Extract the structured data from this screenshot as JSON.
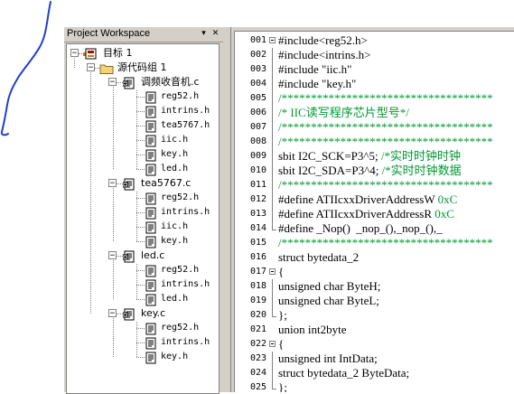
{
  "workspace": {
    "title": "Project Workspace",
    "pin_icon": "pin-icon",
    "close_icon": "close-icon",
    "tree": [
      {
        "id": "target",
        "label": "目标 1",
        "icon": "target-icon",
        "expander": "−",
        "depth": 0
      },
      {
        "id": "group",
        "label": "源代码组 1",
        "icon": "folder-icon",
        "expander": "−",
        "depth": 1
      },
      {
        "id": "f1",
        "label": "调频收音机.c",
        "icon": "c-file-icon",
        "expander": "−",
        "depth": 2
      },
      {
        "id": "f1a",
        "label": "reg52.h",
        "icon": "header-file-icon",
        "depth": 3
      },
      {
        "id": "f1b",
        "label": "intrins.h",
        "icon": "header-file-icon",
        "depth": 3
      },
      {
        "id": "f1c",
        "label": "tea5767.h",
        "icon": "header-file-icon",
        "depth": 3
      },
      {
        "id": "f1d",
        "label": "iic.h",
        "icon": "header-file-icon",
        "depth": 3
      },
      {
        "id": "f1e",
        "label": "key.h",
        "icon": "header-file-icon",
        "depth": 3
      },
      {
        "id": "f1f",
        "label": "led.h",
        "icon": "header-file-icon",
        "depth": 3
      },
      {
        "id": "f2",
        "label": "tea5767.c",
        "icon": "c-file-icon",
        "expander": "−",
        "depth": 2
      },
      {
        "id": "f2a",
        "label": "reg52.h",
        "icon": "header-file-icon",
        "depth": 3
      },
      {
        "id": "f2b",
        "label": "intrins.h",
        "icon": "header-file-icon",
        "depth": 3
      },
      {
        "id": "f2c",
        "label": "iic.h",
        "icon": "header-file-icon",
        "depth": 3
      },
      {
        "id": "f2d",
        "label": "key.h",
        "icon": "header-file-icon",
        "depth": 3
      },
      {
        "id": "f3",
        "label": "led.c",
        "icon": "c-file-icon",
        "expander": "−",
        "depth": 2
      },
      {
        "id": "f3a",
        "label": "reg52.h",
        "icon": "header-file-icon",
        "depth": 3
      },
      {
        "id": "f3b",
        "label": "intrins.h",
        "icon": "header-file-icon",
        "depth": 3
      },
      {
        "id": "f3c",
        "label": "led.h",
        "icon": "header-file-icon",
        "depth": 3
      },
      {
        "id": "f4",
        "label": "key.c",
        "icon": "c-file-icon",
        "expander": "−",
        "depth": 2
      },
      {
        "id": "f4a",
        "label": "reg52.h",
        "icon": "header-file-icon",
        "depth": 3
      },
      {
        "id": "f4b",
        "label": "intrins.h",
        "icon": "header-file-icon",
        "depth": 3
      },
      {
        "id": "f4c",
        "label": "key.h",
        "icon": "header-file-icon",
        "depth": 3
      }
    ]
  },
  "editor": {
    "lines": [
      {
        "n": "001",
        "text": "#include<reg52.h>",
        "kind": "code",
        "fold": "start"
      },
      {
        "n": "002",
        "text": "#include<intrins.h>",
        "kind": "code",
        "fold": "mid"
      },
      {
        "n": "003",
        "text": "#include \"iic.h\"",
        "kind": "code",
        "fold": "mid"
      },
      {
        "n": "004",
        "text": "#include \"key.h\"",
        "kind": "code",
        "fold": "mid"
      },
      {
        "n": "005",
        "text": "/************************************",
        "kind": "comment",
        "fold": "mid"
      },
      {
        "n": "006",
        "text": "/* IIC读写程序芯片型号*/",
        "kind": "comment",
        "fold": "mid"
      },
      {
        "n": "007",
        "text": "/************************************",
        "kind": "comment",
        "fold": "mid"
      },
      {
        "n": "008",
        "text": "/************************************",
        "kind": "comment",
        "fold": "mid"
      },
      {
        "n": "009",
        "text": "sbit I2C_SCK=P3^5; /*实时时钟时钟",
        "kind": "mixed",
        "code": "sbit I2C_SCK=P3^5; ",
        "comment": "/*实时时钟时钟",
        "fold": "mid"
      },
      {
        "n": "010",
        "text": "sbit I2C_SDA=P3^4; /*实时时钟数据",
        "kind": "mixed",
        "code": "sbit I2C_SDA=P3^4; ",
        "comment": "/*实时时钟数据",
        "fold": "mid"
      },
      {
        "n": "011",
        "text": "/************************************",
        "kind": "comment",
        "fold": "mid"
      },
      {
        "n": "012",
        "text": "#define ATIIcxxDriverAddressW 0xC",
        "kind": "mixed",
        "code": "#define ATIIcxxDriverAddressW ",
        "comment": "0xC",
        "fold": "mid"
      },
      {
        "n": "013",
        "text": "#define ATIIcxxDriverAddressR 0xC",
        "kind": "mixed",
        "code": "#define ATIIcxxDriverAddressR ",
        "comment": "0xC",
        "fold": "mid"
      },
      {
        "n": "014",
        "text": "#define _Nop()  _nop_(),_nop_(),_",
        "kind": "code",
        "fold": "end"
      },
      {
        "n": "015",
        "text": "/************************************",
        "kind": "comment",
        "fold": "none"
      },
      {
        "n": "016",
        "text": "struct bytedata_2",
        "kind": "code",
        "fold": "none"
      },
      {
        "n": "017",
        "text": "{",
        "kind": "code",
        "fold": "start"
      },
      {
        "n": "018",
        "text": "unsigned char ByteH;",
        "kind": "code",
        "fold": "mid"
      },
      {
        "n": "019",
        "text": "unsigned char ByteL;",
        "kind": "code",
        "fold": "mid"
      },
      {
        "n": "020",
        "text": "};",
        "kind": "code",
        "fold": "end"
      },
      {
        "n": "021",
        "text": "union int2byte",
        "kind": "code",
        "fold": "none"
      },
      {
        "n": "022",
        "text": "{",
        "kind": "code",
        "fold": "start"
      },
      {
        "n": "023",
        "text": "unsigned int IntData;",
        "kind": "code",
        "fold": "mid"
      },
      {
        "n": "024",
        "text": "struct bytedata_2 ByteData;",
        "kind": "code",
        "fold": "mid"
      },
      {
        "n": "025",
        "text": "};",
        "kind": "code",
        "fold": "end"
      }
    ]
  },
  "colors": {
    "comment": "#009933",
    "panel_bg": "#d4d0c8",
    "scribble": "#1f3fd1"
  }
}
